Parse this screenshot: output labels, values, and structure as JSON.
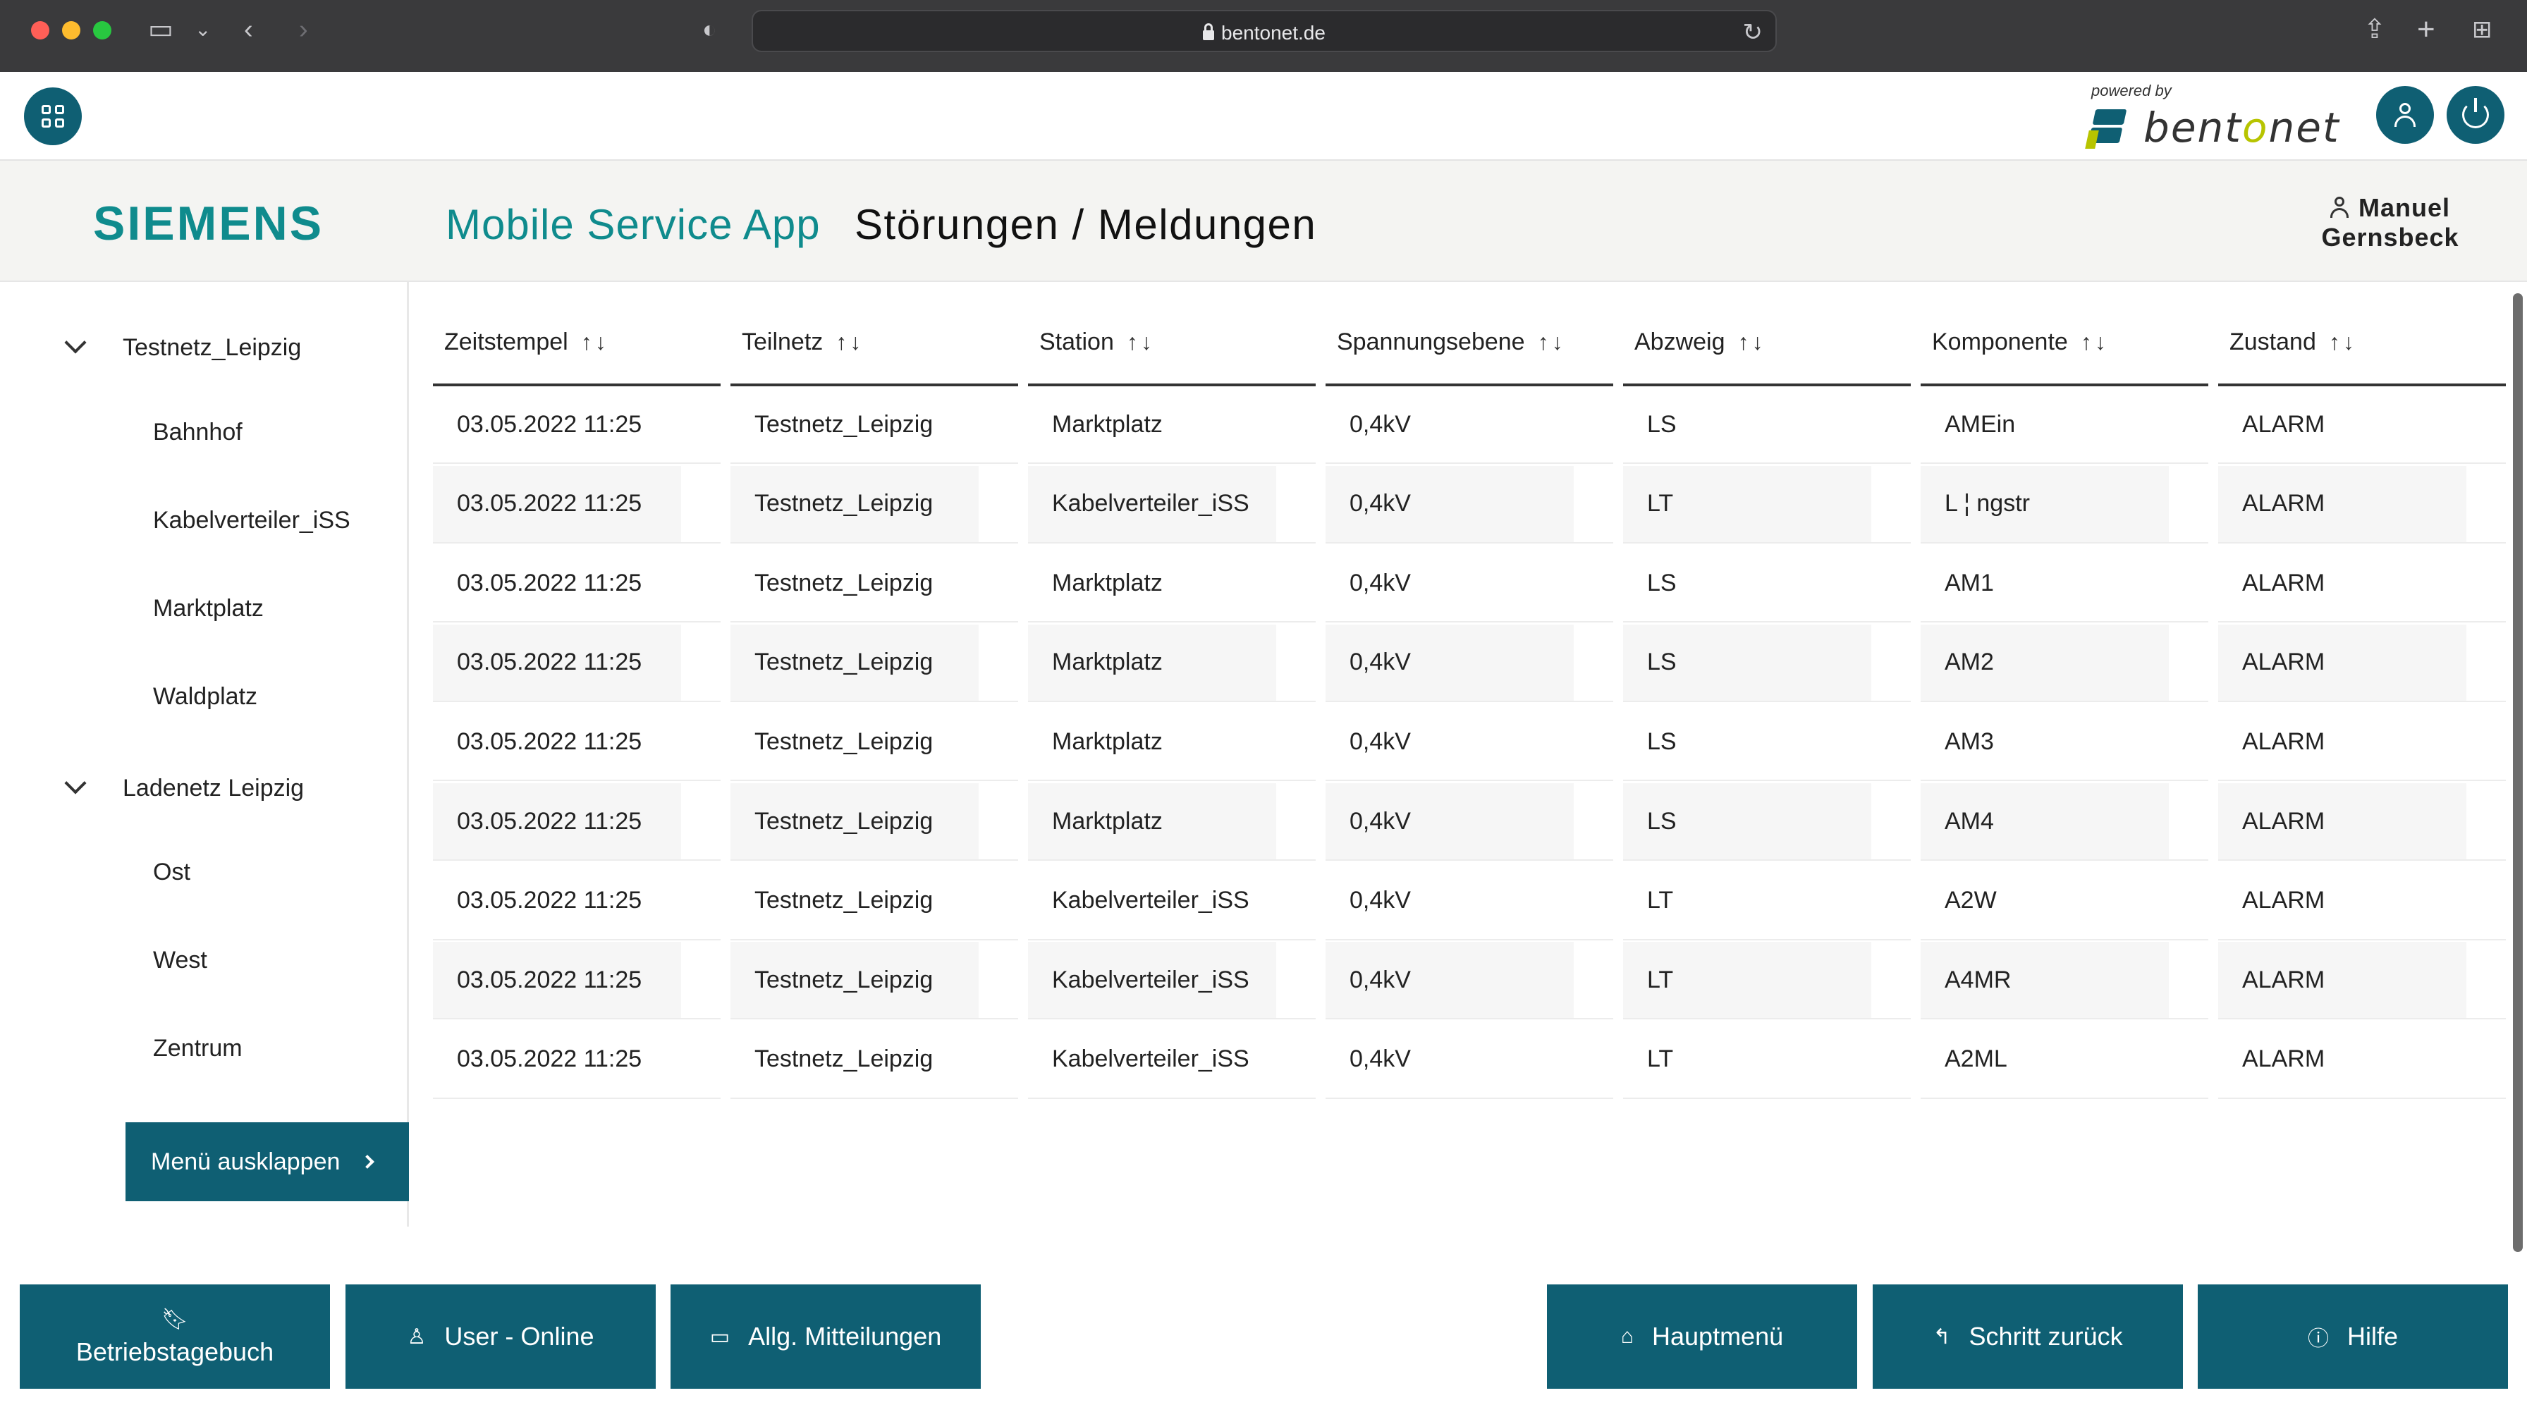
{
  "browser": {
    "url": "bentonet.de"
  },
  "topbar": {
    "powered_by": "powered by",
    "brand_main": "bentonet",
    "brand_prefix": "bent",
    "brand_accent": "o",
    "brand_suffix": "net"
  },
  "header": {
    "company": "SIEMENS",
    "app_name": "Mobile Service App",
    "page_title": "Störungen / Meldungen",
    "user_first": "Manuel",
    "user_last": "Gernsbeck"
  },
  "sidebar": {
    "groups": [
      {
        "label": "Testnetz_Leipzig",
        "items": [
          "Bahnhof",
          "Kabelverteiler_iSS",
          "Marktplatz",
          "Waldplatz"
        ]
      },
      {
        "label": "Ladenetz Leipzig",
        "items": [
          "Ost",
          "West",
          "Zentrum"
        ]
      }
    ],
    "expand_button": "Menü ausklappen"
  },
  "table": {
    "columns": [
      "Zeitstempel",
      "Teilnetz",
      "Station",
      "Spannungsebene",
      "Abzweig",
      "Komponente",
      "Zustand"
    ],
    "rows": [
      [
        "03.05.2022 11:25",
        "Testnetz_Leipzig",
        "Marktplatz",
        "0,4kV",
        "LS",
        "AMEin",
        "ALARM"
      ],
      [
        "03.05.2022 11:25",
        "Testnetz_Leipzig",
        "Kabelverteiler_iSS",
        "0,4kV",
        "LT",
        "L ¦ ngstr",
        "ALARM"
      ],
      [
        "03.05.2022 11:25",
        "Testnetz_Leipzig",
        "Marktplatz",
        "0,4kV",
        "LS",
        "AM1",
        "ALARM"
      ],
      [
        "03.05.2022 11:25",
        "Testnetz_Leipzig",
        "Marktplatz",
        "0,4kV",
        "LS",
        "AM2",
        "ALARM"
      ],
      [
        "03.05.2022 11:25",
        "Testnetz_Leipzig",
        "Marktplatz",
        "0,4kV",
        "LS",
        "AM3",
        "ALARM"
      ],
      [
        "03.05.2022 11:25",
        "Testnetz_Leipzig",
        "Marktplatz",
        "0,4kV",
        "LS",
        "AM4",
        "ALARM"
      ],
      [
        "03.05.2022 11:25",
        "Testnetz_Leipzig",
        "Kabelverteiler_iSS",
        "0,4kV",
        "LT",
        "A2W",
        "ALARM"
      ],
      [
        "03.05.2022 11:25",
        "Testnetz_Leipzig",
        "Kabelverteiler_iSS",
        "0,4kV",
        "LT",
        "A4MR",
        "ALARM"
      ],
      [
        "03.05.2022 11:25",
        "Testnetz_Leipzig",
        "Kabelverteiler_iSS",
        "0,4kV",
        "LT",
        "A2ML",
        "ALARM"
      ]
    ]
  },
  "bottom": {
    "logbook": "Betriebstagebuch",
    "user_online": "User - Online",
    "messages": "Allg. Mitteilungen",
    "main_menu": "Hauptmenü",
    "step_back": "Schritt zurück",
    "help": "Hilfe"
  },
  "colors": {
    "primary": "#0f5f73",
    "teal_text": "#0f8b8d",
    "brand_accent": "#b7c400"
  }
}
